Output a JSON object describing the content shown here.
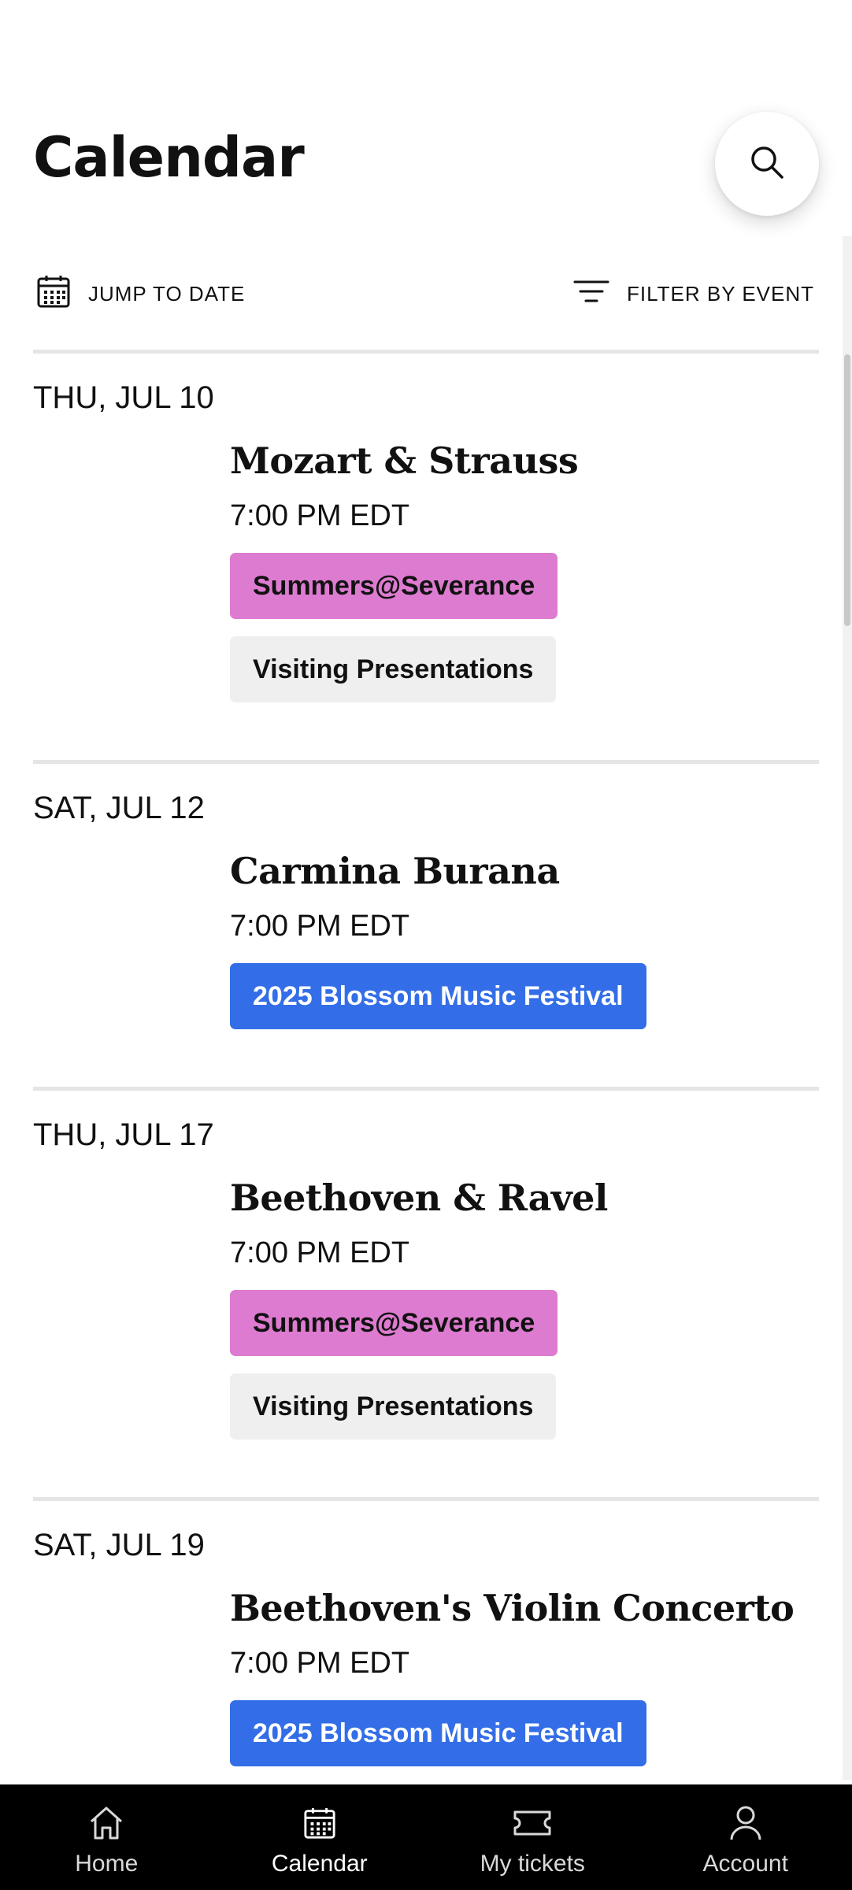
{
  "header": {
    "title": "Calendar"
  },
  "toolbar": {
    "jump_label": "JUMP TO DATE",
    "filter_label": "FILTER BY EVENT"
  },
  "days": [
    {
      "date": "THU, JUL 10",
      "title": "Mozart & Strauss",
      "time": "7:00 PM EDT",
      "tags": [
        {
          "label": "Summers@Severance",
          "bg": "#dd7bd0",
          "fg": "#111111"
        },
        {
          "label": "Visiting Presentations",
          "bg": "#efefef",
          "fg": "#111111"
        }
      ]
    },
    {
      "date": "SAT, JUL 12",
      "title": "Carmina Burana",
      "time": "7:00 PM EDT",
      "tags": [
        {
          "label": "2025 Blossom Music Festival",
          "bg": "#336ee8",
          "fg": "#ffffff"
        }
      ]
    },
    {
      "date": "THU, JUL 17",
      "title": "Beethoven & Ravel",
      "time": "7:00 PM EDT",
      "tags": [
        {
          "label": "Summers@Severance",
          "bg": "#dd7bd0",
          "fg": "#111111"
        },
        {
          "label": "Visiting Presentations",
          "bg": "#efefef",
          "fg": "#111111"
        }
      ]
    },
    {
      "date": "SAT, JUL 19",
      "title": "Beethoven's Violin Concerto",
      "time": "7:00 PM EDT",
      "tags": [
        {
          "label": "2025 Blossom Music Festival",
          "bg": "#336ee8",
          "fg": "#ffffff"
        }
      ]
    }
  ],
  "nav": {
    "items": [
      {
        "label": "Home",
        "icon": "home-icon"
      },
      {
        "label": "Calendar",
        "icon": "calendar-icon",
        "active": true
      },
      {
        "label": "My tickets",
        "icon": "ticket-icon"
      },
      {
        "label": "Account",
        "icon": "account-icon"
      }
    ]
  }
}
